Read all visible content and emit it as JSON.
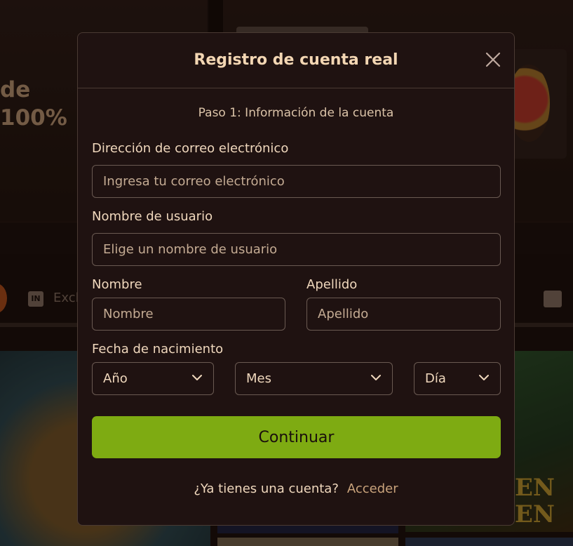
{
  "background": {
    "banner_text_lines": [
      "de",
      "100%"
    ],
    "nav_label": "Excl",
    "nav_icon": "in-logo-icon",
    "tile_letters": [
      "EN",
      "EN"
    ]
  },
  "modal": {
    "title": "Registro de cuenta real",
    "step": "Paso 1: Información de la cuenta",
    "close_icon": "close-icon",
    "email": {
      "label": "Dirección de correo electrónico",
      "placeholder": "Ingresa tu correo electrónico",
      "value": ""
    },
    "username": {
      "label": "Nombre de usuario",
      "placeholder": "Elige un nombre de usuario",
      "value": ""
    },
    "first_name": {
      "label": "Nombre",
      "placeholder": "Nombre",
      "value": ""
    },
    "last_name": {
      "label": "Apellido",
      "placeholder": "Apellido",
      "value": ""
    },
    "birthdate": {
      "label": "Fecha de nacimiento",
      "year": "Año",
      "month": "Mes",
      "day": "Día"
    },
    "continue_label": "Continuar",
    "footer_question": "¿Ya tienes una cuenta?",
    "footer_link": "Acceder"
  },
  "colors": {
    "accent_button": "#7eab12",
    "modal_bg": "#1f1211",
    "title_text": "#f3d6b3",
    "link_text": "#c9a37c"
  }
}
